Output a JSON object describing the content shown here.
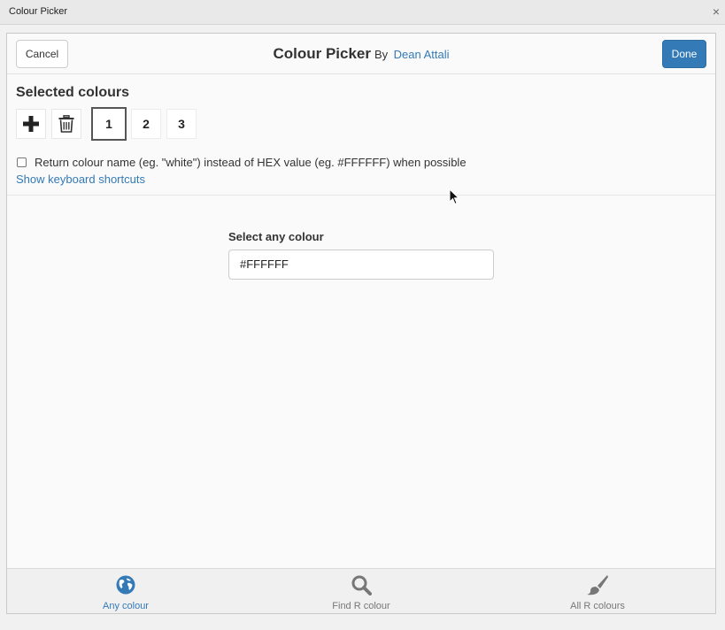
{
  "window": {
    "title": "Colour Picker",
    "close_glyph": "×"
  },
  "header": {
    "cancel_label": "Cancel",
    "title": "Colour Picker",
    "by_text": "By",
    "author": "Dean Attali",
    "done_label": "Done"
  },
  "selected": {
    "heading": "Selected colours",
    "add_icon": "plus-icon",
    "delete_icon": "trash-icon",
    "colours": [
      "1",
      "2",
      "3"
    ],
    "active_index": 0,
    "checkbox_label": "Return colour name (eg. \"white\") instead of HEX value (eg. #FFFFFF) when possible",
    "checkbox_checked": false,
    "shortcuts_link": "Show keyboard shortcuts"
  },
  "picker": {
    "label": "Select any colour",
    "value": "#FFFFFF"
  },
  "tabs": [
    {
      "label": "Any colour",
      "icon": "globe-icon",
      "active": true
    },
    {
      "label": "Find R colour",
      "icon": "search-icon",
      "active": false
    },
    {
      "label": "All R colours",
      "icon": "paintbrush-icon",
      "active": false
    }
  ],
  "colors": {
    "accent": "#337ab7",
    "inactive_tab": "#777777"
  }
}
